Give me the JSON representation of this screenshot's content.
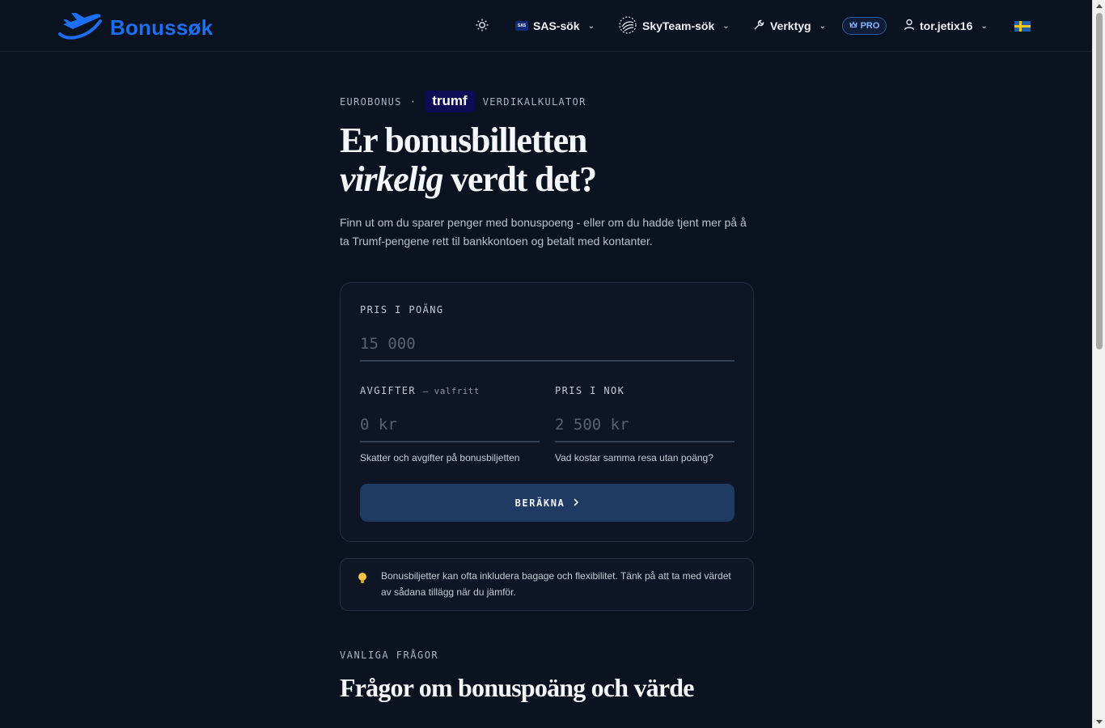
{
  "brand": {
    "name": "Bonussøk"
  },
  "nav": {
    "sas_search": "SAS-sök",
    "sas_badge": "SAS",
    "skyteam_search": "SkyTeam-sök",
    "tools": "Verktyg",
    "pro": "PRO",
    "username": "tor.jetix16",
    "language_flag": "sweden-flag-icon"
  },
  "hero": {
    "eyebrow_left": "EUROBONUS",
    "eyebrow_sep": "·",
    "partner": "trumf",
    "eyebrow_right": "VERDIKALKULATOR",
    "title_line1": "Er bonusbilletten",
    "title_italic": "virkelig",
    "title_line2_rest": " verdt det?",
    "lead": "Finn ut om du sparer penger med bonuspoeng - eller om du hadde tjent mer på å ta Trumf-pengene rett til bankkontoen og betalt med kontanter."
  },
  "form": {
    "points_label": "PRIS I POÄNG",
    "points_placeholder": "15 000",
    "fees_label": "AVGIFTER",
    "fees_optional": "– valfritt",
    "fees_placeholder": "0 kr",
    "fees_hint": "Skatter och avgifter på bonusbiljetten",
    "price_label": "PRIS I NOK",
    "price_placeholder": "2 500 kr",
    "price_hint": "Vad kostar samma resa utan poäng?",
    "submit": "BERÄKNA"
  },
  "tip": {
    "icon": "lightbulb-icon",
    "text": "Bonusbiljetter kan ofta inkludera bagage och flexibilitet. Tänk på att ta med värdet av sådana tillägg när du jämför."
  },
  "faq": {
    "eyebrow": "VANLIGA FRÅGOR",
    "title": "Frågor om bonuspoäng och värde"
  },
  "colors": {
    "background": "#0b1220",
    "accent": "#1b6ff2",
    "button": "#1f3a63",
    "trumf": "#0e0b55"
  }
}
